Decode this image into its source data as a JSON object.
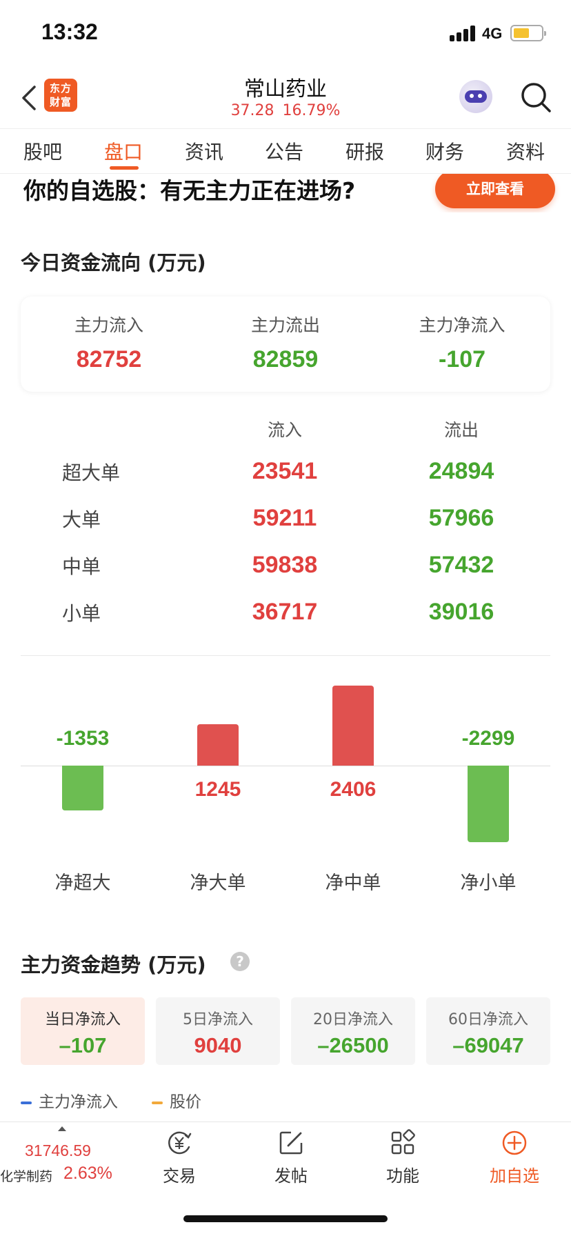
{
  "status_bar": {
    "time": "13:32",
    "network": "4G"
  },
  "header": {
    "brand_logo": [
      "东方",
      "财富"
    ],
    "title": "常山药业",
    "price": "37.28",
    "change": "16.79%"
  },
  "tabs": [
    "股吧",
    "盘口",
    "资讯",
    "公告",
    "研报",
    "财务",
    "资料"
  ],
  "active_tab": "盘口",
  "banner": {
    "text": "你的自选股：有无主力正在进场?",
    "button": "立即查看"
  },
  "fund_flow": {
    "title": "今日资金流向 (万元)",
    "summary": [
      {
        "label": "主力流入",
        "value": "82752",
        "tone": "red"
      },
      {
        "label": "主力流出",
        "value": "82859",
        "tone": "green"
      },
      {
        "label": "主力净流入",
        "value": "-107",
        "tone": "green"
      }
    ],
    "columns": [
      "流入",
      "流出"
    ],
    "rows": [
      {
        "label": "超大单",
        "inflow": "23541",
        "outflow": "24894"
      },
      {
        "label": "大单",
        "inflow": "59211",
        "outflow": "57966"
      },
      {
        "label": "中单",
        "inflow": "59838",
        "outflow": "57432"
      },
      {
        "label": "小单",
        "inflow": "36717",
        "outflow": "39016"
      }
    ]
  },
  "chart_data": {
    "type": "bar",
    "categories": [
      "净超大",
      "净大单",
      "净中单",
      "净小单"
    ],
    "values": [
      -1353,
      1245,
      2406,
      -2299
    ],
    "colors": {
      "positive": "#e0514f",
      "negative": "#6cbd52"
    }
  },
  "trend": {
    "title": "主力资金趋势 (万元)",
    "help_icon": "question-icon",
    "periods": [
      {
        "label": "当日净流入",
        "value": "–107",
        "tone": "green",
        "active": true
      },
      {
        "label": "5日净流入",
        "value": "9040",
        "tone": "red",
        "active": false
      },
      {
        "label": "20日净流入",
        "value": "–26500",
        "tone": "green",
        "active": false
      },
      {
        "label": "60日净流入",
        "value": "–69047",
        "tone": "green",
        "active": false
      }
    ],
    "legend": [
      {
        "label": "主力净流入",
        "color": "#3a6fd8"
      },
      {
        "label": "股价",
        "color": "#f2a93b"
      }
    ]
  },
  "bottom_bar": {
    "index_value": "31746.59",
    "index_name": "化学制药",
    "index_change": "2.63%",
    "nav": [
      {
        "label": "交易",
        "icon": "trade-yen-icon"
      },
      {
        "label": "发帖",
        "icon": "compose-icon"
      },
      {
        "label": "功能",
        "icon": "grid-icon"
      },
      {
        "label": "加自选",
        "icon": "add-circle-icon"
      }
    ]
  },
  "colors": {
    "up": "#e0403e",
    "down": "#46a52e",
    "accent": "#ef5a24"
  }
}
